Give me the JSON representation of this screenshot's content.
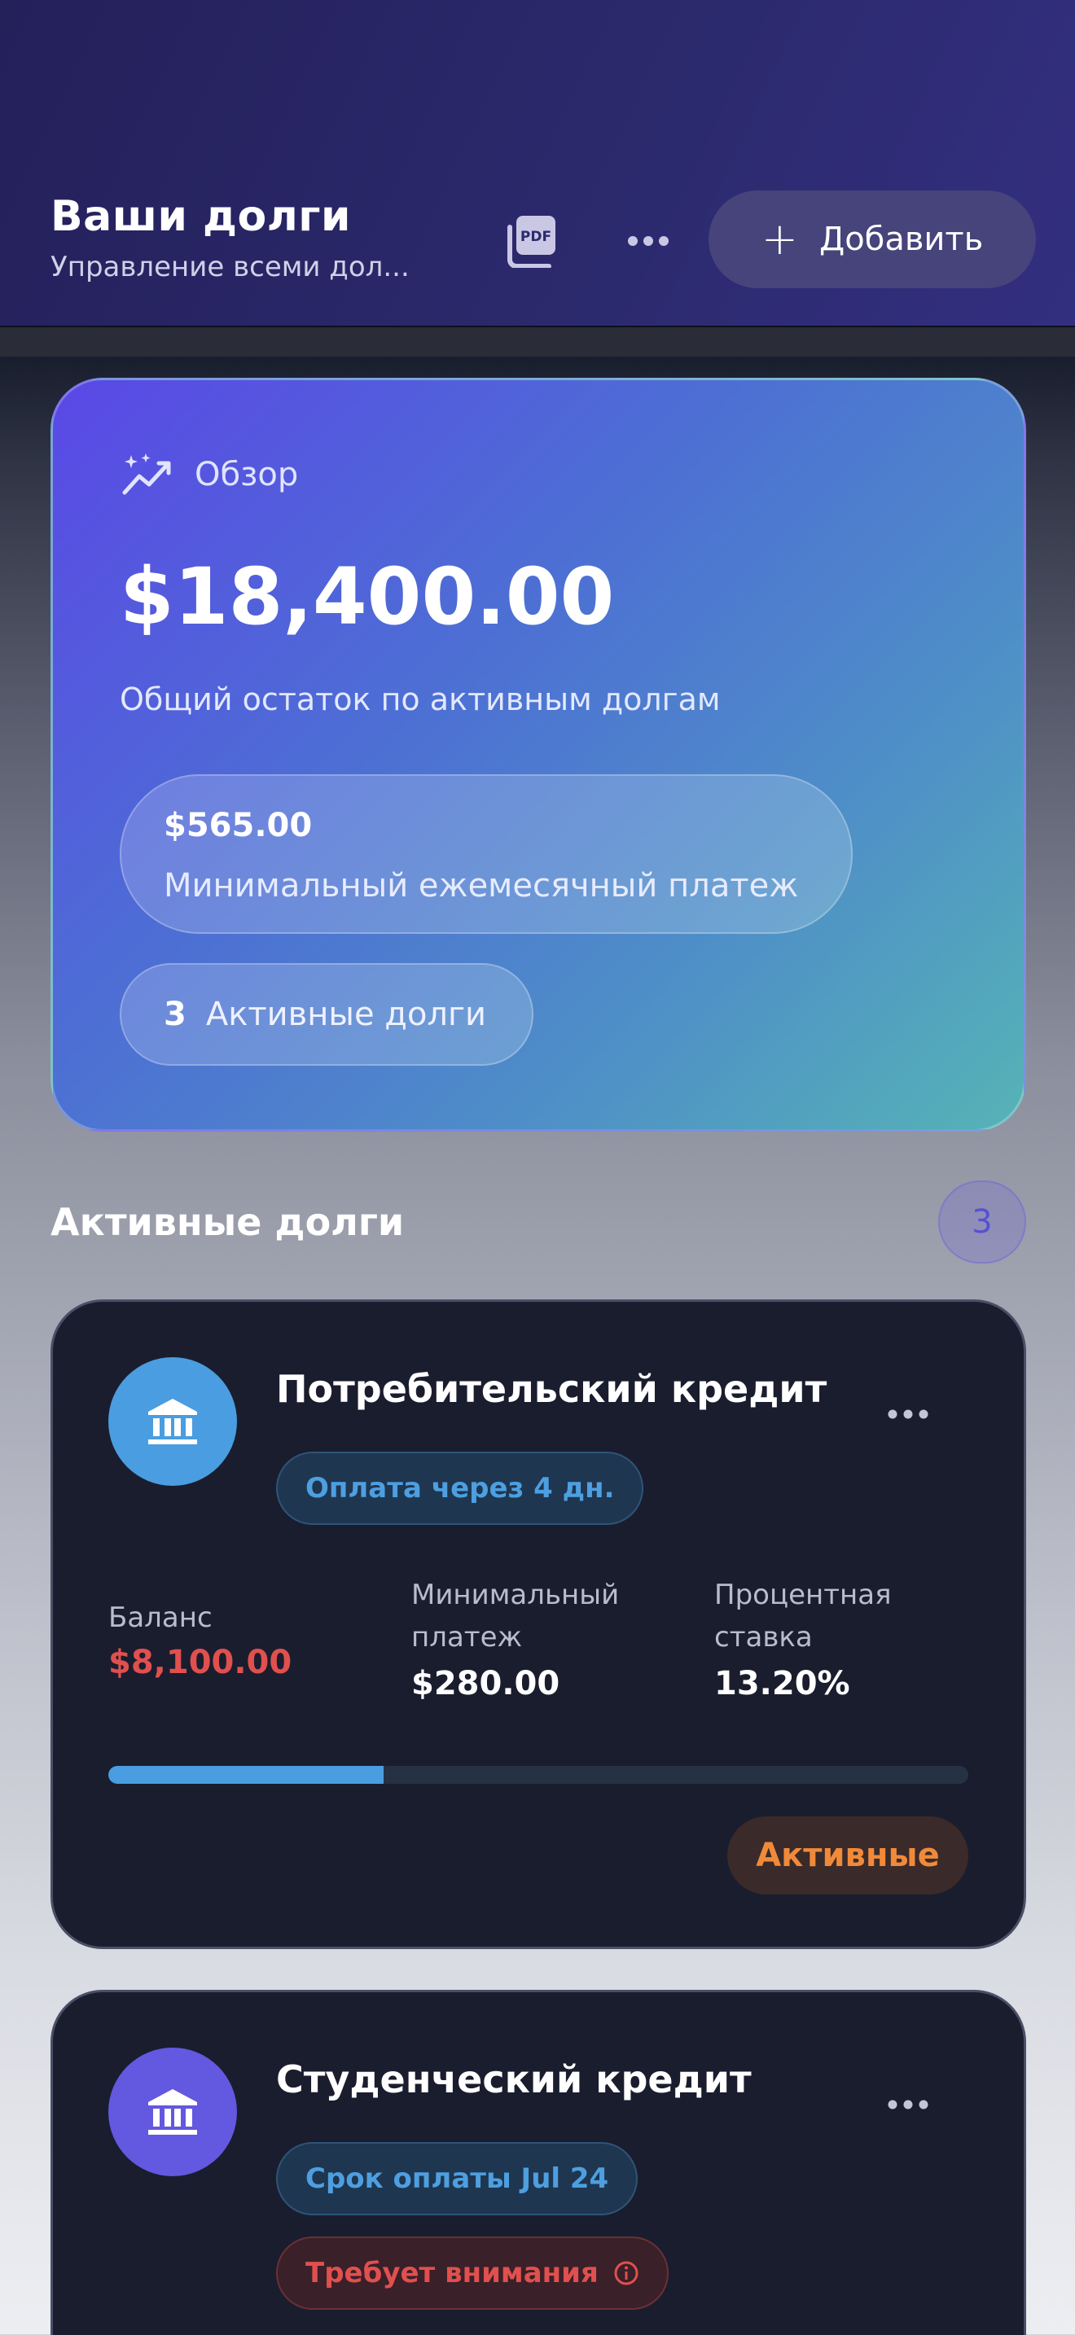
{
  "header": {
    "title": "Ваши долги",
    "subtitle": "Управление всеми дол...",
    "pdf_icon": "pdf-icon",
    "more_icon": "more-horizontal-icon",
    "add_label": "Добавить"
  },
  "overview": {
    "label": "Обзор",
    "icon": "sparkles-chart-icon",
    "total_amount": "$18,400.00",
    "total_desc": "Общий остаток по активным долгам",
    "min_payment_value": "$565.00",
    "min_payment_label": "Минимальный ежемесячный платеж",
    "active_count": "3",
    "active_label": "Активные долги"
  },
  "section": {
    "title": "Активные долги",
    "count": "3"
  },
  "debts": [
    {
      "name": "Потребительский кредит",
      "icon": "bank-icon",
      "color": "#4a9de0",
      "due_badge": "Оплата через 4 дн.",
      "balance_label": "Баланс",
      "balance": "$8,100.00",
      "min_label": "Минимальный платеж",
      "min_line1": "Минимальный",
      "min_line2": "платеж",
      "min_payment": "$280.00",
      "rate_line1": "Процентная",
      "rate_line2": "ставка",
      "rate": "13.20%",
      "progress": 0.32,
      "status": "Активные"
    },
    {
      "name": "Студенческий кредит",
      "icon": "bank-icon",
      "color": "#6358e0",
      "due_badge": "Срок оплаты Jul 24",
      "warning_badge": "Требует внимания"
    }
  ],
  "colors": {
    "accent": "#4a9de0",
    "balance_red": "#e0504e",
    "status_orange": "#f08a3a"
  }
}
